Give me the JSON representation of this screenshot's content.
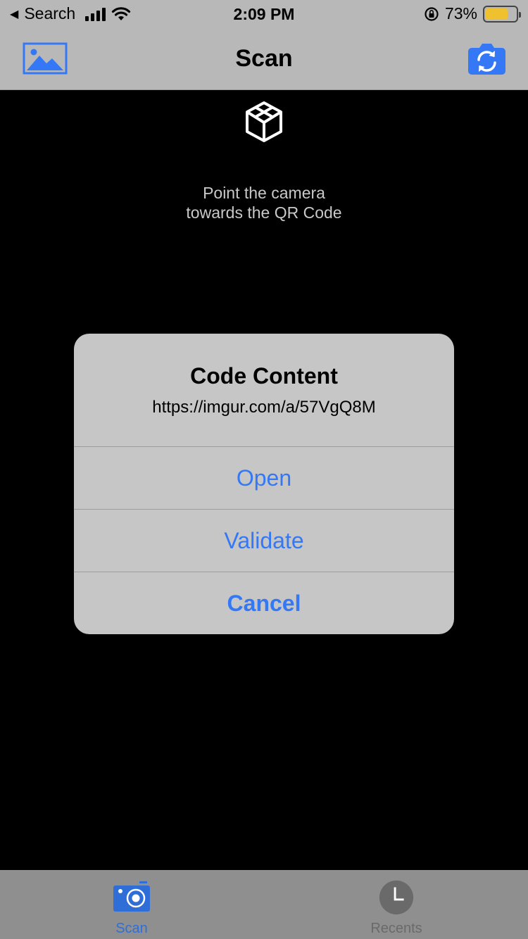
{
  "status_bar": {
    "back_label": "Search",
    "time": "2:09 PM",
    "battery": "73%",
    "battery_level": 0.73
  },
  "nav": {
    "title": "Scan",
    "left_icon": "photo-library-icon",
    "right_icon": "switch-camera-icon"
  },
  "camera": {
    "instruction_line1": "Point the camera",
    "instruction_line2": "towards the QR Code"
  },
  "alert": {
    "title": "Code Content",
    "message": "https://imgur.com/a/57VgQ8M",
    "buttons": [
      {
        "label": "Open"
      },
      {
        "label": "Validate"
      },
      {
        "label": "Cancel"
      }
    ]
  },
  "tabs": [
    {
      "label": "Scan",
      "icon": "camera-icon",
      "selected": true
    },
    {
      "label": "Recents",
      "icon": "clock-icon",
      "selected": false
    }
  ],
  "colors": {
    "accent": "#3478f6",
    "tab_selected": "#2f6ed7",
    "battery": "#f0c12e"
  }
}
